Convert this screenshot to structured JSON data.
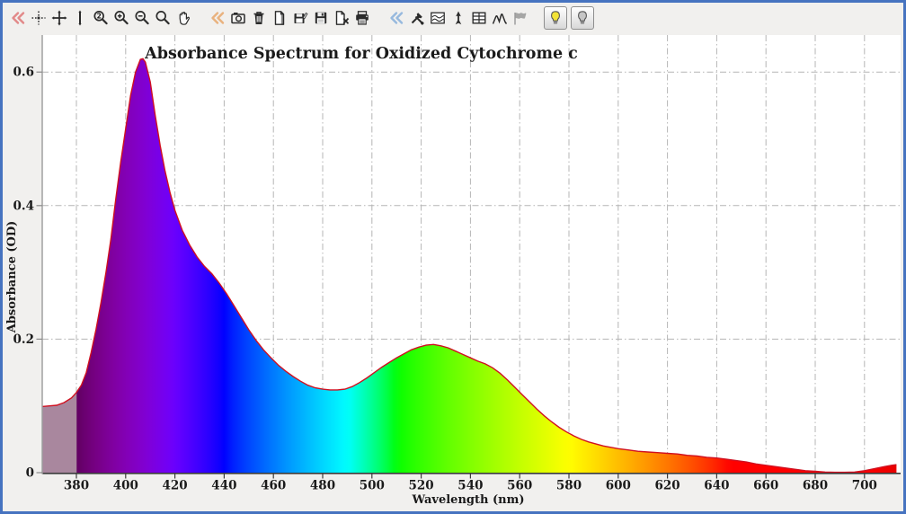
{
  "window": {
    "border_color": "#4673c0",
    "background_color": "#f1f0ee"
  },
  "toolbar": {
    "items": [
      {
        "name": "collapse-view-group",
        "icon": "double-chevron-icon",
        "color": "#e28989"
      },
      {
        "name": "tracking-cursor",
        "icon": "dotted-crosshair-icon"
      },
      {
        "name": "move-cursor",
        "icon": "move-crosshair-icon"
      },
      {
        "name": "vertical-cursor",
        "icon": "vertical-bar-icon"
      },
      {
        "name": "zoom-region",
        "icon": "magnifier-2-icon"
      },
      {
        "name": "zoom-in",
        "icon": "magnifier-plus-icon"
      },
      {
        "name": "zoom-out",
        "icon": "magnifier-minus-icon"
      },
      {
        "name": "zoom-tool",
        "icon": "magnifier-icon"
      },
      {
        "name": "pan-tool",
        "icon": "hand-icon"
      },
      {
        "name": "collapse-file-group",
        "icon": "double-chevron-icon",
        "color": "#e9b27e",
        "gap": true
      },
      {
        "name": "snapshot",
        "icon": "camera-icon"
      },
      {
        "name": "delete-data",
        "icon": "trash-icon"
      },
      {
        "name": "new-page",
        "icon": "page-icon"
      },
      {
        "name": "save-edited",
        "icon": "floppy-pencil-icon"
      },
      {
        "name": "save",
        "icon": "floppy-icon"
      },
      {
        "name": "close-page",
        "icon": "page-x-icon"
      },
      {
        "name": "print",
        "icon": "printer-icon"
      },
      {
        "name": "collapse-analysis-group",
        "icon": "double-chevron-icon",
        "color": "#97b9de",
        "gap": true
      },
      {
        "name": "experiment-setup",
        "icon": "crossed-tools-icon"
      },
      {
        "name": "spectrum-overlay",
        "icon": "spectrum-box-icon"
      },
      {
        "name": "cursor-marker",
        "icon": "dart-icon"
      },
      {
        "name": "data-table",
        "icon": "table-icon"
      },
      {
        "name": "peak-analysis",
        "icon": "peaks-icon"
      },
      {
        "name": "baseline-flag",
        "icon": "flag-icon",
        "disabled": true
      },
      {
        "name": "lamp-on",
        "icon": "bulb-on-icon",
        "boxed": true,
        "active": true,
        "gap": true
      },
      {
        "name": "lamp-off",
        "icon": "bulb-off-icon",
        "boxed": true
      }
    ]
  },
  "chart_data": {
    "type": "area",
    "title": "Absorbance Spectrum for Oxidized Cytochrome c",
    "xlabel": "Wavelength (nm)",
    "ylabel": "Absorbance (OD)",
    "xlim": [
      366,
      713
    ],
    "ylim": [
      0,
      0.635
    ],
    "xticks": [
      380,
      400,
      420,
      440,
      460,
      480,
      500,
      520,
      540,
      560,
      580,
      600,
      620,
      640,
      660,
      680,
      700
    ],
    "yticks": [
      0,
      0.2,
      0.4,
      0.6
    ],
    "ytick_labels": [
      "0",
      "0.2",
      "0.4",
      "0.6"
    ],
    "grid": true,
    "grid_style": "dash-dot",
    "grid_color": "#b5b5b5",
    "line_color": "#d01020",
    "fill_style": "visible-light-spectrum-gradient-by-wavelength",
    "uv_region_fill_color": "#a9879e",
    "legend": "none",
    "series": [
      {
        "name": "Oxidized Cytochrome c",
        "points": [
          [
            366,
            0.099
          ],
          [
            369,
            0.1
          ],
          [
            372,
            0.101
          ],
          [
            375,
            0.105
          ],
          [
            378,
            0.112
          ],
          [
            380,
            0.12
          ],
          [
            382,
            0.131
          ],
          [
            384,
            0.15
          ],
          [
            386,
            0.18
          ],
          [
            388,
            0.215
          ],
          [
            390,
            0.255
          ],
          [
            392,
            0.3
          ],
          [
            394,
            0.35
          ],
          [
            396,
            0.41
          ],
          [
            398,
            0.465
          ],
          [
            400,
            0.515
          ],
          [
            402,
            0.565
          ],
          [
            404,
            0.6
          ],
          [
            406,
            0.619
          ],
          [
            407,
            0.62
          ],
          [
            408,
            0.615
          ],
          [
            410,
            0.585
          ],
          [
            412,
            0.535
          ],
          [
            414,
            0.49
          ],
          [
            416,
            0.452
          ],
          [
            418,
            0.42
          ],
          [
            420,
            0.393
          ],
          [
            423,
            0.363
          ],
          [
            426,
            0.341
          ],
          [
            429,
            0.323
          ],
          [
            432,
            0.309
          ],
          [
            435,
            0.298
          ],
          [
            438,
            0.284
          ],
          [
            441,
            0.268
          ],
          [
            444,
            0.25
          ],
          [
            447,
            0.232
          ],
          [
            450,
            0.214
          ],
          [
            453,
            0.198
          ],
          [
            456,
            0.184
          ],
          [
            459,
            0.172
          ],
          [
            462,
            0.161
          ],
          [
            465,
            0.152
          ],
          [
            468,
            0.144
          ],
          [
            471,
            0.137
          ],
          [
            474,
            0.131
          ],
          [
            477,
            0.127
          ],
          [
            480,
            0.125
          ],
          [
            483,
            0.124
          ],
          [
            486,
            0.124
          ],
          [
            489,
            0.125
          ],
          [
            492,
            0.129
          ],
          [
            495,
            0.135
          ],
          [
            498,
            0.142
          ],
          [
            501,
            0.15
          ],
          [
            504,
            0.158
          ],
          [
            507,
            0.165
          ],
          [
            510,
            0.172
          ],
          [
            513,
            0.178
          ],
          [
            516,
            0.184
          ],
          [
            519,
            0.188
          ],
          [
            522,
            0.191
          ],
          [
            525,
            0.192
          ],
          [
            528,
            0.19
          ],
          [
            531,
            0.187
          ],
          [
            534,
            0.182
          ],
          [
            537,
            0.177
          ],
          [
            540,
            0.172
          ],
          [
            543,
            0.167
          ],
          [
            546,
            0.163
          ],
          [
            549,
            0.157
          ],
          [
            552,
            0.149
          ],
          [
            555,
            0.139
          ],
          [
            558,
            0.128
          ],
          [
            561,
            0.117
          ],
          [
            564,
            0.106
          ],
          [
            567,
            0.095
          ],
          [
            570,
            0.085
          ],
          [
            573,
            0.076
          ],
          [
            576,
            0.068
          ],
          [
            579,
            0.061
          ],
          [
            582,
            0.055
          ],
          [
            585,
            0.05
          ],
          [
            588,
            0.046
          ],
          [
            591,
            0.043
          ],
          [
            594,
            0.04
          ],
          [
            597,
            0.038
          ],
          [
            600,
            0.036
          ],
          [
            604,
            0.034
          ],
          [
            608,
            0.032
          ],
          [
            612,
            0.031
          ],
          [
            616,
            0.03
          ],
          [
            620,
            0.029
          ],
          [
            624,
            0.028
          ],
          [
            628,
            0.026
          ],
          [
            632,
            0.025
          ],
          [
            636,
            0.023
          ],
          [
            640,
            0.022
          ],
          [
            644,
            0.02
          ],
          [
            648,
            0.018
          ],
          [
            652,
            0.016
          ],
          [
            656,
            0.013
          ],
          [
            660,
            0.011
          ],
          [
            664,
            0.009
          ],
          [
            668,
            0.007
          ],
          [
            672,
            0.005
          ],
          [
            676,
            0.003
          ],
          [
            680,
            0.002
          ],
          [
            684,
            0.001
          ],
          [
            688,
            0.0005
          ],
          [
            692,
            0.0005
          ],
          [
            696,
            0.001
          ],
          [
            700,
            0.003
          ],
          [
            704,
            0.006
          ],
          [
            708,
            0.009
          ],
          [
            711,
            0.011
          ],
          [
            713,
            0.012
          ]
        ]
      }
    ]
  }
}
